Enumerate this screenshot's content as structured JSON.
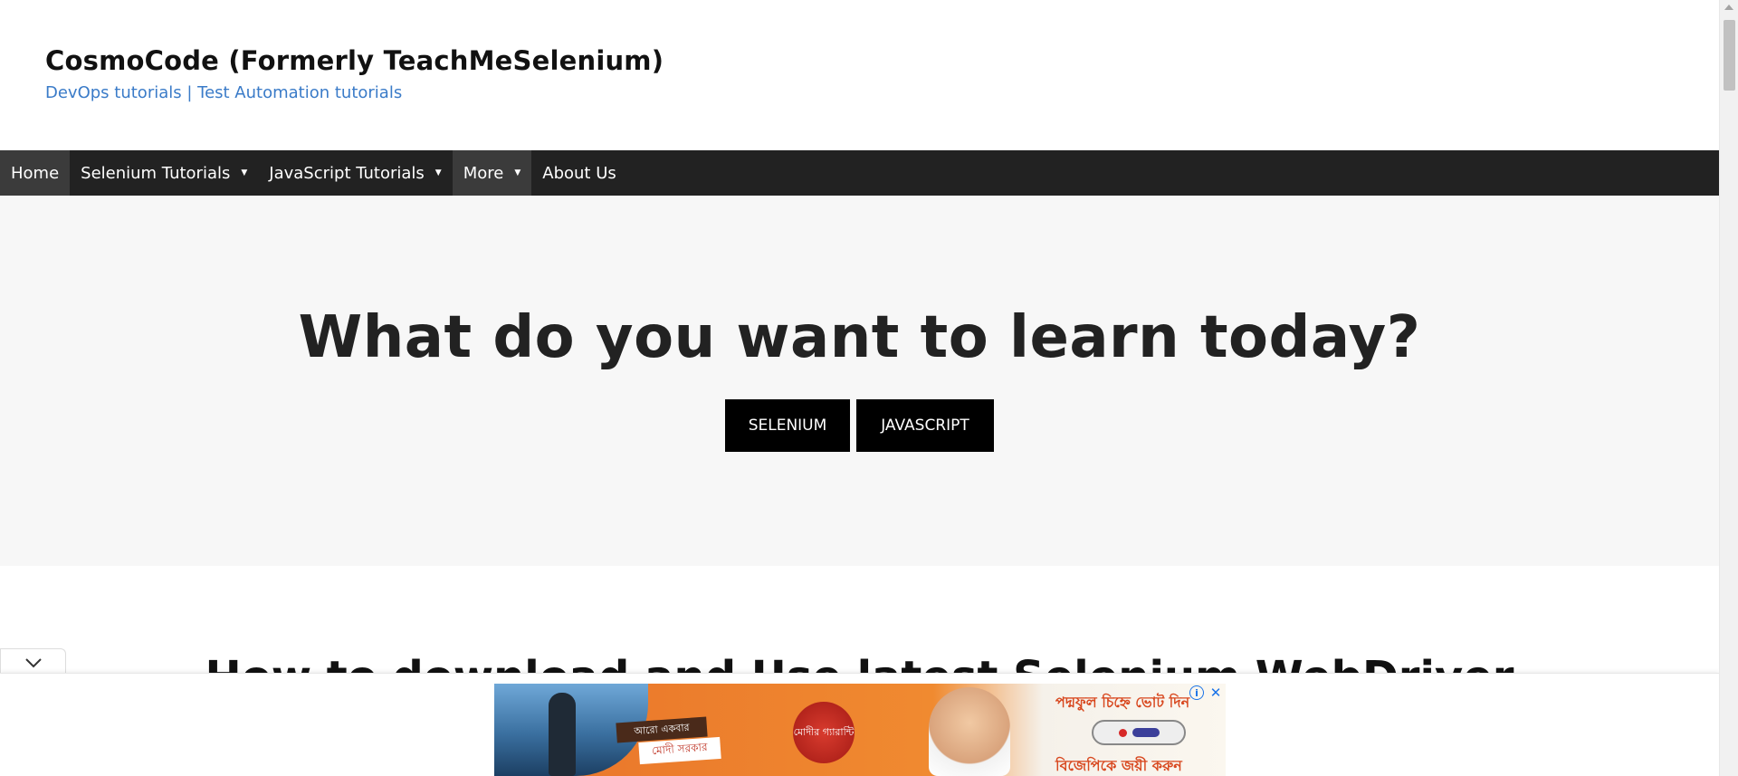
{
  "header": {
    "site_title": "CosmoCode (Formerly TeachMeSelenium)",
    "tagline": "DevOps tutorials | Test Automation tutorials"
  },
  "nav": {
    "items": [
      {
        "label": "Home",
        "active": true,
        "has_dropdown": false
      },
      {
        "label": "Selenium Tutorials",
        "active": false,
        "has_dropdown": true
      },
      {
        "label": "JavaScript Tutorials",
        "active": false,
        "has_dropdown": true
      },
      {
        "label": "More",
        "active": true,
        "has_dropdown": true
      },
      {
        "label": "About Us",
        "active": false,
        "has_dropdown": false
      }
    ],
    "caret_glyph": "▼"
  },
  "hero": {
    "title": "What do you want to learn today?",
    "buttons": [
      {
        "label": "SELENIUM"
      },
      {
        "label": "JAVASCRIPT"
      }
    ]
  },
  "section_peek": {
    "title": "How to download and Use latest Selenium WebDriver"
  },
  "ad": {
    "toggle_icon": "chevron-down-icon",
    "label_line1": "আরো একবার",
    "label_line2": "মোদী সরকার",
    "seal_text": "মোদীর গ্যারান্টি",
    "headline": "পদ্মফুল চিহ্নে ভোট দিন",
    "cta": "বিজেপিকে জয়ী করুন",
    "info_glyph": "i",
    "close_glyph": "✕"
  },
  "colors": {
    "nav_bg": "#222222",
    "nav_active_bg": "#3b3b3b",
    "tagline": "#3a7bc8",
    "hero_bg": "#f7f7f7",
    "button_bg": "#000000",
    "ad_accent": "#e9742a"
  }
}
